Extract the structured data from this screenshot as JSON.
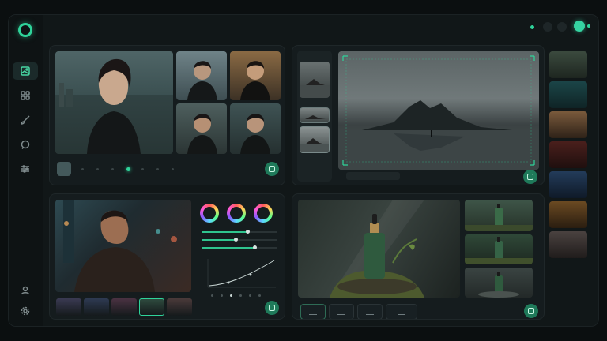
{
  "sidebar": {
    "items": [
      {
        "icon": "image-icon",
        "active": true
      },
      {
        "icon": "grid-icon",
        "active": false
      },
      {
        "icon": "brush-icon",
        "active": false
      },
      {
        "icon": "chat-icon",
        "active": false
      },
      {
        "icon": "sliders-icon",
        "active": false
      }
    ],
    "bottom": [
      {
        "icon": "user-icon"
      },
      {
        "icon": "gear-icon"
      }
    ]
  },
  "colors": {
    "accent": "#2fd39a",
    "accent_dark": "#1f7a5a",
    "panel": "#151c1e",
    "background": "#111718"
  },
  "portrait_gallery": {
    "pagination": {
      "pages": 7,
      "current": 4
    }
  },
  "landscape_editor": {
    "filmstrip_count": 3,
    "selected_thumb": 2
  },
  "color_grading": {
    "wheels": 3,
    "sliders": [
      {
        "value": 0.6
      },
      {
        "value": 0.45
      },
      {
        "value": 0.7
      }
    ],
    "film_thumbs": 5,
    "selected_thumb": 4
  },
  "product_shot": {
    "variations": 3,
    "tools": [
      {
        "icon": "align-left-icon",
        "active": true
      },
      {
        "icon": "align-center-icon",
        "active": false
      },
      {
        "icon": "layout-icon",
        "active": false
      },
      {
        "icon": "text-icon",
        "active": false
      }
    ]
  },
  "style_strip": {
    "count": 7
  }
}
